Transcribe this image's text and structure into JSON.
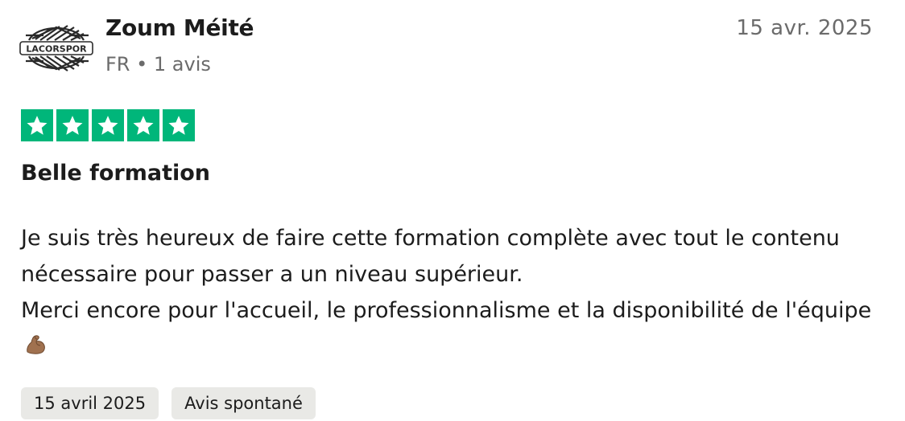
{
  "reviewer": {
    "avatar_text": "LACORSPOR",
    "name": "Zoum Méité",
    "meta": "FR • 1 avis"
  },
  "review": {
    "date": "15 avr. 2025",
    "rating": 5,
    "rating_max": 5,
    "star_color": "#00b67a",
    "title": "Belle formation",
    "body_line1": "Je suis très heureux de faire cette formation complète avec tout le contenu nécessaire pour passer a un niveau supérieur.",
    "body_line2": "Merci encore pour l'accueil, le professionnalisme et la disponibilité de l'équipe",
    "emoji_icon": "flexed-biceps-icon"
  },
  "tags": {
    "experience_date": "15 avril 2025",
    "review_type": "Avis spontané"
  }
}
